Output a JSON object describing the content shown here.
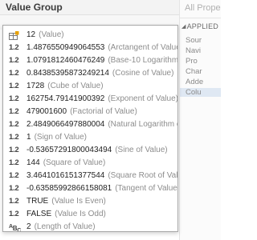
{
  "header": {
    "column_title": "Value Group"
  },
  "right_pane": {
    "all_properties": "All Prope",
    "section_label": "APPLIED",
    "items": [
      "Sour",
      "Navi",
      "Pro",
      "Char",
      "Adde",
      "Colu"
    ]
  },
  "popup": {
    "rows": [
      {
        "icon": "table-icon",
        "value": "12",
        "desc": "(Value)"
      },
      {
        "icon": "decimal-number-icon",
        "value": "1.4876550949064553",
        "desc": "(Arctangent of Value)"
      },
      {
        "icon": "decimal-number-icon",
        "value": "1.0791812460476249",
        "desc": "(Base-10 Logarithm of Value)"
      },
      {
        "icon": "decimal-number-icon",
        "value": "0.84385395873249214",
        "desc": "(Cosine of Value)"
      },
      {
        "icon": "decimal-number-icon",
        "value": "1728",
        "desc": "(Cube of Value)"
      },
      {
        "icon": "decimal-number-icon",
        "value": "162754.79141900392",
        "desc": "(Exponent of Value)"
      },
      {
        "icon": "decimal-number-icon",
        "value": "479001600",
        "desc": "(Factorial of Value)"
      },
      {
        "icon": "decimal-number-icon",
        "value": "2.4849066497880004",
        "desc": "(Natural Logarithm of Value)"
      },
      {
        "icon": "decimal-number-icon",
        "value": "1",
        "desc": "(Sign of Value)"
      },
      {
        "icon": "decimal-number-icon",
        "value": "-0.53657291800043494",
        "desc": "(Sine of Value)"
      },
      {
        "icon": "decimal-number-icon",
        "value": "144",
        "desc": "(Square of Value)"
      },
      {
        "icon": "decimal-number-icon",
        "value": "3.4641016151377544",
        "desc": "(Square Root of Value)"
      },
      {
        "icon": "decimal-number-icon",
        "value": "-0.63585992866158081",
        "desc": "(Tangent of Value)"
      },
      {
        "icon": "decimal-number-icon",
        "value": "TRUE",
        "desc": "(Value Is Even)"
      },
      {
        "icon": "decimal-number-icon",
        "value": "FALSE",
        "desc": "(Value Is Odd)"
      },
      {
        "icon": "text-type-icon",
        "value": "2",
        "desc": "(Length of Value)"
      }
    ],
    "decimal_icon_text": "1.2",
    "text_icon_text": "ABC"
  }
}
